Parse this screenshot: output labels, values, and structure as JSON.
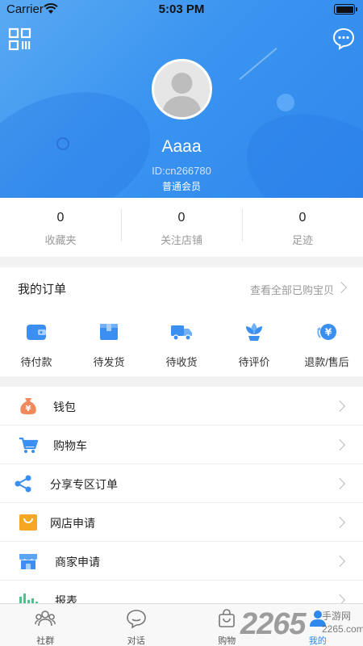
{
  "status_bar": {
    "carrier": "Carrier",
    "time": "5:03 PM"
  },
  "profile": {
    "name": "Aaaa",
    "id_text": "ID:cn266780",
    "level": "普通会员",
    "header_color": "#3a94f0"
  },
  "stats": [
    {
      "value": "0",
      "label": "收藏夹"
    },
    {
      "value": "0",
      "label": "关注店铺"
    },
    {
      "value": "0",
      "label": "足迹"
    }
  ],
  "orders": {
    "title": "我的订单",
    "view_all": "查看全部已购宝贝",
    "items": [
      {
        "label": "待付款",
        "icon": "wallet-icon"
      },
      {
        "label": "待发货",
        "icon": "package-icon"
      },
      {
        "label": "待收货",
        "icon": "truck-icon"
      },
      {
        "label": "待评价",
        "icon": "flower-icon"
      },
      {
        "label": "退款/售后",
        "icon": "refund-icon"
      }
    ]
  },
  "menu": [
    {
      "label": "钱包",
      "icon": "money-bag-icon"
    },
    {
      "label": "购物车",
      "icon": "cart-icon"
    },
    {
      "label": "分享专区订单",
      "icon": "share-icon"
    },
    {
      "label": "网店申请",
      "icon": "shopping-bag-icon"
    },
    {
      "label": "商家申请",
      "icon": "store-icon"
    },
    {
      "label": "报表",
      "icon": "bar-chart-icon"
    }
  ],
  "tabbar": [
    {
      "label": "社群",
      "icon": "community-icon",
      "active": false
    },
    {
      "label": "对话",
      "icon": "chat-bubble-icon",
      "active": false
    },
    {
      "label": "购物",
      "icon": "shopping-bag-icon",
      "active": false
    },
    {
      "label": "我的",
      "icon": "profile-icon",
      "active": true
    }
  ],
  "watermark": {
    "number": "2265",
    "text": "手游网",
    "url": "2265.com"
  },
  "accent_color": "#2f88ec"
}
